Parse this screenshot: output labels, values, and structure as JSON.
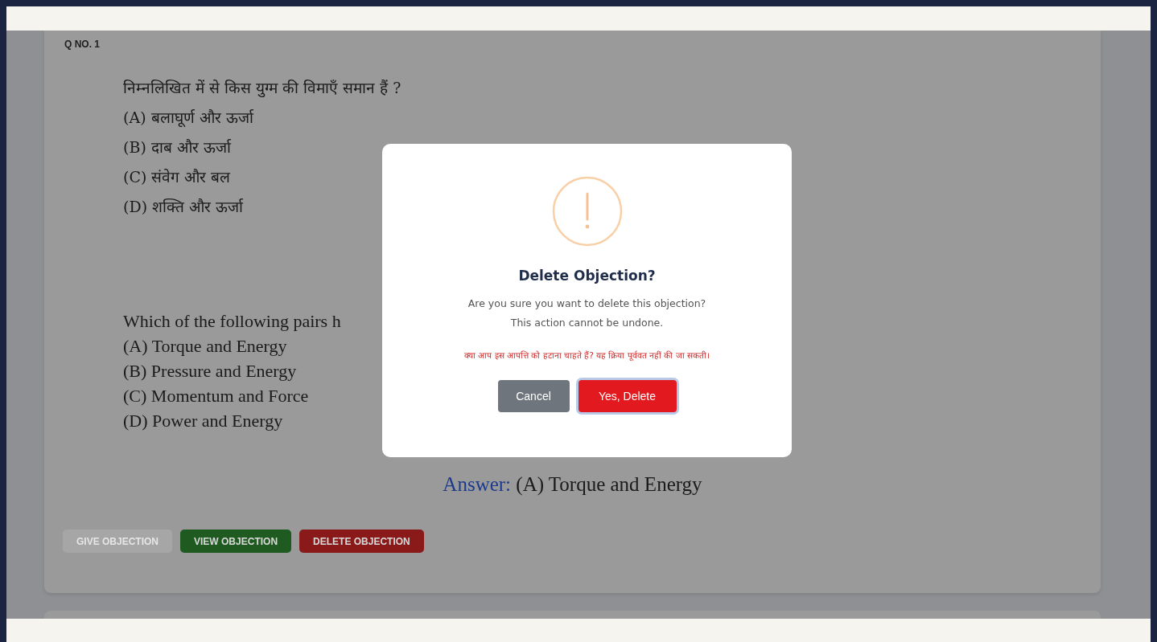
{
  "question": {
    "number": "Q NO. 1",
    "hindi": {
      "text": "निम्नलिखित में से किस युग्म की विमाएँ समान हैं ?",
      "options": [
        "(A) बलाघूर्ण और ऊर्जा",
        "(B) दाब और ऊर्जा",
        "(C) संवेग और बल",
        "(D) शक्ति और ऊर्जा"
      ]
    },
    "english": {
      "text": "Which of the following pairs h",
      "options": [
        "(A) Torque and Energy",
        "(B) Pressure and Energy",
        "(C) Momentum and Force",
        "(D) Power and Energy"
      ]
    },
    "answer": {
      "label": "Answer:",
      "text": "(A) Torque and Energy"
    }
  },
  "actions": [
    {
      "label": "GIVE OBJECTION",
      "kind": "give",
      "disabled": true
    },
    {
      "label": "VIEW OBJECTION",
      "kind": "view",
      "disabled": false
    },
    {
      "label": "DELETE OBJECTION",
      "kind": "delete",
      "disabled": false
    }
  ],
  "dialog": {
    "title": "Delete Objection?",
    "message_lines": [
      "Are you sure you want to delete this objection?",
      "This action cannot be undone."
    ],
    "hindi_message": "क्या आप इस आपत्ति को हटाना चाहते हैं? यह क्रिया पूर्ववत नहीं की जा सकती।",
    "buttons": [
      {
        "label": "Cancel",
        "kind": "cancel",
        "focused": false
      },
      {
        "label": "Yes, Delete",
        "kind": "confirm",
        "focused": true
      }
    ]
  }
}
